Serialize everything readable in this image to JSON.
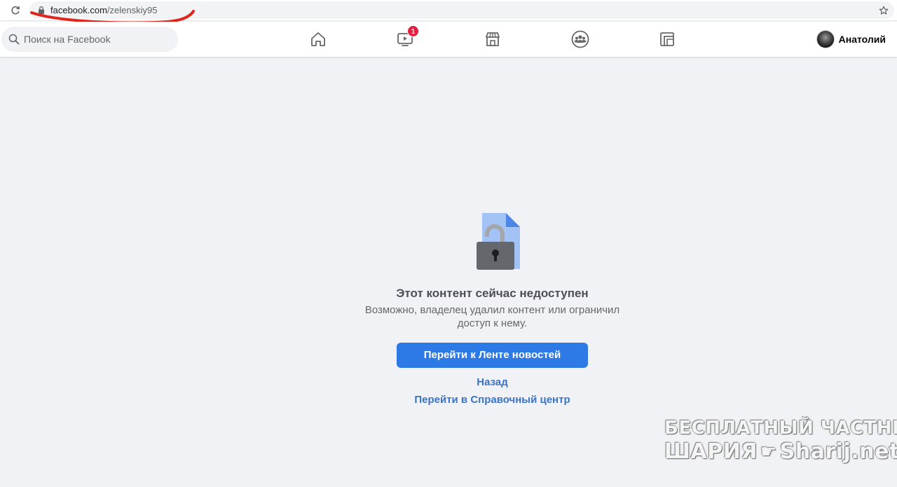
{
  "browser": {
    "url_host": "facebook.com",
    "url_path": "/zelenskiy95",
    "reload_icon": "reload-icon",
    "lock_icon": "lock-icon",
    "bookmark_icon": "star-icon",
    "annotation_color": "#e0261c"
  },
  "fb_nav": {
    "search_placeholder": "Поиск на Facebook",
    "icons": [
      "home-icon",
      "watch-icon",
      "marketplace-icon",
      "groups-icon",
      "gaming-icon"
    ],
    "watch_badge": "1",
    "profile_name": "Анатолий"
  },
  "content": {
    "headline": "Этот контент сейчас недоступен",
    "subtext": "Возможно, владелец удалил контент или ограничил доступ к нему.",
    "primary_button": "Перейти к Ленте новостей",
    "link_back": "Назад",
    "link_help": "Перейти в Справочный центр"
  },
  "watermark": {
    "line1": "БЕСПЛАТНЫЙ ЧАСТНЫЙ",
    "line2_left": "ШАРИЯ",
    "line2_right": "Sharij.net"
  },
  "colors": {
    "fb_blue_button": "#2d7ae6",
    "link_blue": "#3b73c7",
    "badge_red": "#e41e3f",
    "page_bg": "#f0f2f5"
  }
}
